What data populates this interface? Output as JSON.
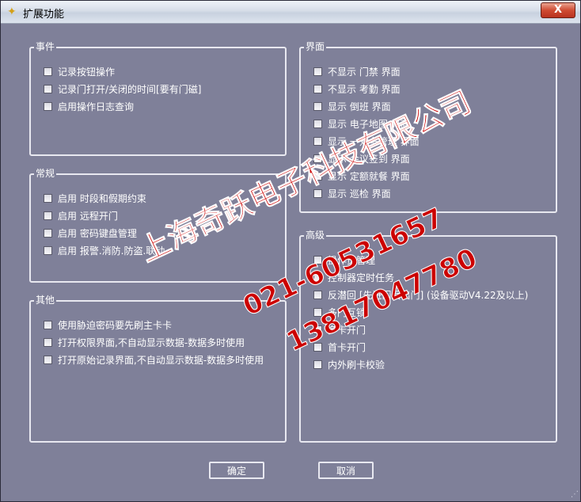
{
  "window": {
    "title": "扩展功能",
    "close_label": "X"
  },
  "groups": {
    "events": {
      "title": "事件",
      "items": [
        "记录按钮操作",
        "记录门打开/关闭的时间[要有门磁]",
        "启用操作日志查询"
      ]
    },
    "general": {
      "title": "常规",
      "items": [
        "启用 时段和假期约束",
        "启用 远程开门",
        "启用 密码键盘管理",
        "启用 报警.消防.防盗.联动"
      ]
    },
    "other": {
      "title": "其他",
      "items": [
        "使用胁迫密码要先刷主卡卡",
        "打开权限界面,不自动显示数据-数据多时使用",
        "打开原始记录界面,不自动显示数据-数据多时使用"
      ]
    },
    "interface": {
      "title": "界面",
      "items": [
        "不显示 门禁 界面",
        "不显示 考勤 界面",
        "显示 倒班 界面",
        "显示 电子地图 界面",
        "显示 一对多管理 界面",
        "显示 会议签到 界面",
        "显示 定额就餐 界面",
        "显示 巡检 界面"
      ]
    },
    "advanced": {
      "title": "高级",
      "items": [
        "操作员管理",
        "控制器定时任务",
        "反潜回 [先进门后出门] (设备驱动V4.22及以上)",
        "多门互锁",
        "多卡开门",
        "首卡开门",
        "内外刷卡校验"
      ]
    }
  },
  "buttons": {
    "ok": "确定",
    "cancel": "取消"
  },
  "watermark": {
    "company": "上海奇跃电子科技有限公司",
    "phone1": "021-60531657",
    "phone2": "13817047780"
  }
}
